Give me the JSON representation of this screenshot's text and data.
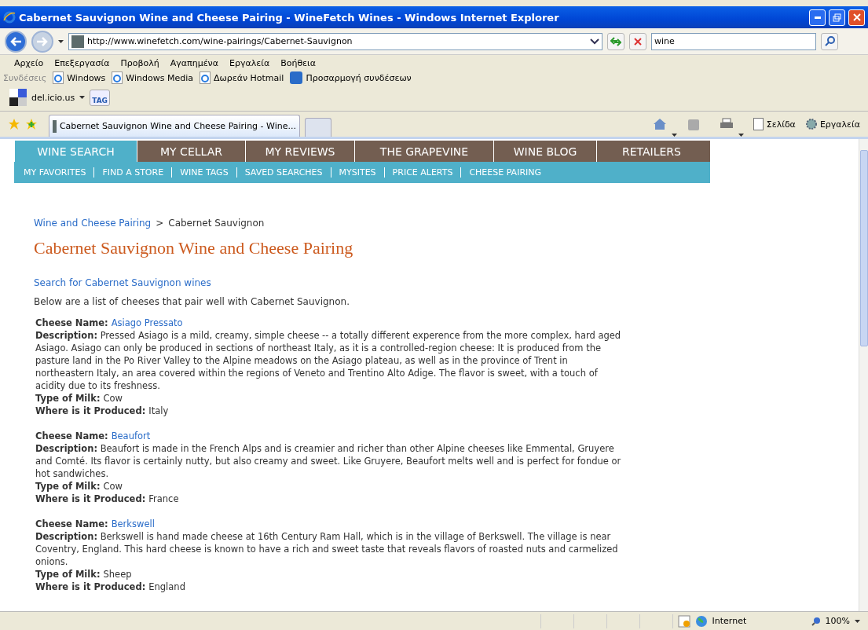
{
  "window": {
    "title": "Cabernet Sauvignon Wine and Cheese Pairing - WineFetch Wines - Windows Internet Explorer"
  },
  "address_bar": {
    "url": "http://www.winefetch.com/wine-pairings/Cabernet-Sauvignon"
  },
  "search": {
    "value": "wine"
  },
  "menu": [
    "Αρχείο",
    "Επεξεργασία",
    "Προβολή",
    "Αγαπημένα",
    "Εργαλεία",
    "Βοήθεια"
  ],
  "links_bar": {
    "label": "Συνδέσεις",
    "items": [
      {
        "label": "Windows",
        "kind": "ie"
      },
      {
        "label": "Windows Media",
        "kind": "ie"
      },
      {
        "label": "Δωρεάν Hotmail",
        "kind": "ie"
      },
      {
        "label": "Προσαρμογή συνδέσεων",
        "kind": "msn"
      }
    ]
  },
  "delicious": {
    "label": "del.icio.us",
    "tag": "TAG"
  },
  "browser_tabs": [
    {
      "label": "Cabernet Sauvignon Wine and Cheese Pairing - Wine...",
      "selected": true
    }
  ],
  "command_bar": [
    {
      "label": "Σελίδα",
      "kind": "page"
    },
    {
      "label": "Εργαλεία",
      "kind": "tools"
    }
  ],
  "nav": [
    {
      "label": "WINE SEARCH",
      "selected": true
    },
    {
      "label": "MY CELLAR",
      "selected": false
    },
    {
      "label": "MY REVIEWS",
      "selected": false
    },
    {
      "label": "THE GRAPEVINE",
      "selected": false
    },
    {
      "label": "WINE BLOG",
      "selected": false
    },
    {
      "label": "RETAILERS",
      "selected": false
    }
  ],
  "subnav": [
    "MY FAVORITES",
    "FIND A STORE",
    "WINE TAGS",
    "SAVED SEARCHES",
    "MYSITES",
    "PRICE ALERTS",
    "CHEESE PAIRING"
  ],
  "breadcrumb": {
    "link": "Wine and Cheese Pairing",
    "separator": ">",
    "current": "Cabernet Sauvignon"
  },
  "heading": "Cabernet Sauvignon Wine and Cheese Pairing",
  "search_link": "Search for Cabernet Sauvignon wines",
  "intro": "Below are a list of cheeses that pair well with Cabernet Sauvignon.",
  "cheeses": [
    {
      "name_label": "Cheese Name:",
      "name": "Asiago Pressato",
      "description_label": "Description:",
      "description": "Pressed Asiago is a mild, creamy, simple cheese -- a totally different experence from the more complex, hard aged Asiago. Asiago can only be produced in sections of northeast Italy, as it is a controlled-region cheese: It is produced from the pasture land in the Po River Valley to the Alpine meadows on the Asiago plateau, as well as in the province of Trent in northeastern Italy, an area covered within the regions of Veneto and Trentino Alto Adige. The flavor is sweet, with a touch of acidity due to its freshness.",
      "milk_label": "Type of Milk:",
      "milk": "Cow",
      "origin_label": "Where is it Produced:",
      "origin": "Italy"
    },
    {
      "name_label": "Cheese Name:",
      "name": "Beaufort",
      "description_label": "Description:",
      "description": "Beaufort is made in the French Alps and is creamier and richer than other Alpine cheeses like Emmental, Gruyere and Comté. Its flavor is certainly nutty, but also creamy and sweet. Like Gruyere, Beaufort melts well and is perfect for fondue or hot sandwiches.",
      "milk_label": "Type of Milk:",
      "milk": "Cow",
      "origin_label": "Where is it Produced:",
      "origin": "France"
    },
    {
      "name_label": "Cheese Name:",
      "name": "Berkswell",
      "description_label": "Description:",
      "description": "Berkswell is hand made cheese at 16th Century Ram Hall, which is in the village of Berkswell. The village is near Coventry, England. This hard cheese is known to have a rich and sweet taste that reveals flavors of roasted nuts and carmelized onions.",
      "milk_label": "Type of Milk:",
      "milk": "Sheep",
      "origin_label": "Where is it Produced:",
      "origin": "England"
    }
  ],
  "status_bar": {
    "zone": "Internet",
    "zoom": "100%"
  }
}
